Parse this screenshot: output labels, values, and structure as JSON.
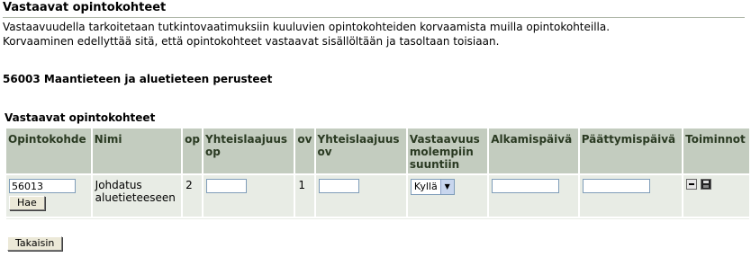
{
  "page": {
    "title": "Vastaavat opintokohteet",
    "intro_line1": "Vastaavuudella tarkoitetaan tutkintovaatimuksiin kuuluvien opintokohteiden korvaamista muilla opintokohteilla.",
    "intro_line2": "Korvaaminen edellyttää sitä, että opintokohteet vastaavat sisällöltään ja tasoltaan toisiaan.",
    "course_heading": "56003 Maantieteen ja aluetieteen perusteet",
    "section_heading": "Vastaavat opintokohteet"
  },
  "table": {
    "headers": {
      "opintokohde": "Opintokohde",
      "nimi": "Nimi",
      "op": "op",
      "yhteislaajuus_op": "Yhteislaajuus op",
      "ov": "ov",
      "yhteislaajuus_ov": "Yhteislaajuus ov",
      "vastaavuus": "Vastaavuus molempiin suuntiin",
      "alkamispaiva": "Alkamispäivä",
      "paattymispaiva": "Päättymispäivä",
      "toiminnot": "Toiminnot"
    },
    "row": {
      "opintokohde_value": "56013",
      "hae_label": "Hae",
      "nimi": "Johdatus aluetieteeseen",
      "op": "2",
      "yhteislaajuus_op_value": "",
      "ov": "1",
      "yhteislaajuus_ov_value": "",
      "vastaavuus_selected": "Kyllä",
      "alkamispaiva_value": "",
      "paattymispaiva_value": ""
    }
  },
  "buttons": {
    "back_label": "Takaisin"
  },
  "icons": {
    "remove": "minus-icon",
    "save": "floppy-disk-icon",
    "dropdown": "chevron-down-icon"
  },
  "colors": {
    "header_bg": "#c3ccbf",
    "row_bg": "#e8ece5",
    "header_text": "#2a3a22"
  }
}
